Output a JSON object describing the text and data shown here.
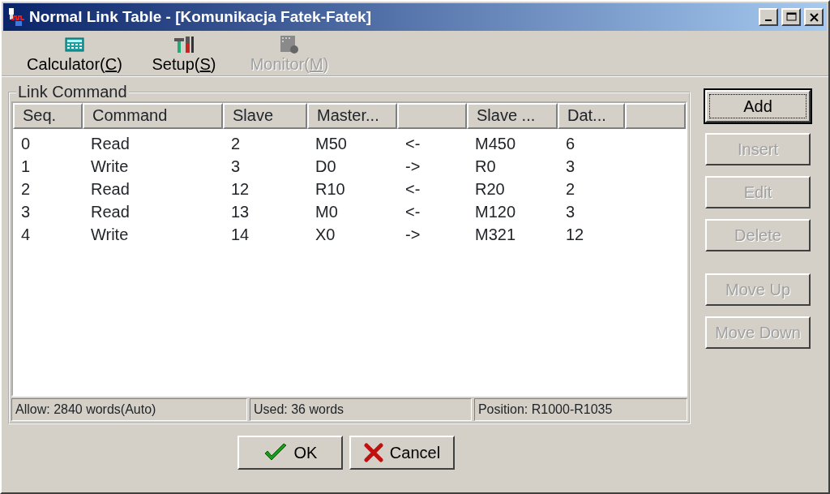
{
  "window": {
    "title": "Normal Link Table - [Komunikacja Fatek-Fatek]"
  },
  "toolbar": [
    {
      "label": "Calculator(",
      "mnemonic": "C",
      "suffix": ")",
      "kind": "calculator",
      "disabled": false
    },
    {
      "label": "Setup(",
      "mnemonic": "S",
      "suffix": ")",
      "kind": "tools",
      "disabled": false
    },
    {
      "label": "Monitor(",
      "mnemonic": "M",
      "suffix": ")",
      "kind": "monitor",
      "disabled": true
    }
  ],
  "group": {
    "title": "Link Command"
  },
  "table": {
    "columns": [
      {
        "label": "Seq."
      },
      {
        "label": "Command"
      },
      {
        "label": "Slave"
      },
      {
        "label": "Master..."
      },
      {},
      {
        "label": "Slave ..."
      },
      {
        "label": "Dat..."
      }
    ],
    "rows": [
      [
        "0",
        "Read",
        "2",
        "M50",
        "<-",
        "M450",
        "6"
      ],
      [
        "1",
        "Write",
        "3",
        "D0",
        "->",
        "R0",
        "3"
      ],
      [
        "2",
        "Read",
        "12",
        "R10",
        "<-",
        "R20",
        "2"
      ],
      [
        "3",
        "Read",
        "13",
        "M0",
        "<-",
        "M120",
        "3"
      ],
      [
        "4",
        "Write",
        "14",
        "X0",
        "->",
        "M321",
        "12"
      ]
    ]
  },
  "status_bar": [
    "Allow: 2840 words(Auto)",
    "Used: 36 words",
    "Position: R1000-R1035"
  ],
  "side_buttons": [
    {
      "label": "Add",
      "disabled": false,
      "default": true
    },
    {
      "label": "Insert",
      "disabled": true,
      "default": false
    },
    {
      "label": "Edit",
      "disabled": true,
      "default": false
    },
    {
      "label": "Delete",
      "disabled": true,
      "default": false
    },
    {
      "label": "Move Up",
      "disabled": true,
      "default": false
    },
    {
      "label": "Move Down",
      "disabled": true,
      "default": false
    }
  ],
  "dialog_buttons": [
    {
      "label": "OK",
      "kind": "check"
    },
    {
      "label": "Cancel",
      "kind": "cross"
    }
  ]
}
